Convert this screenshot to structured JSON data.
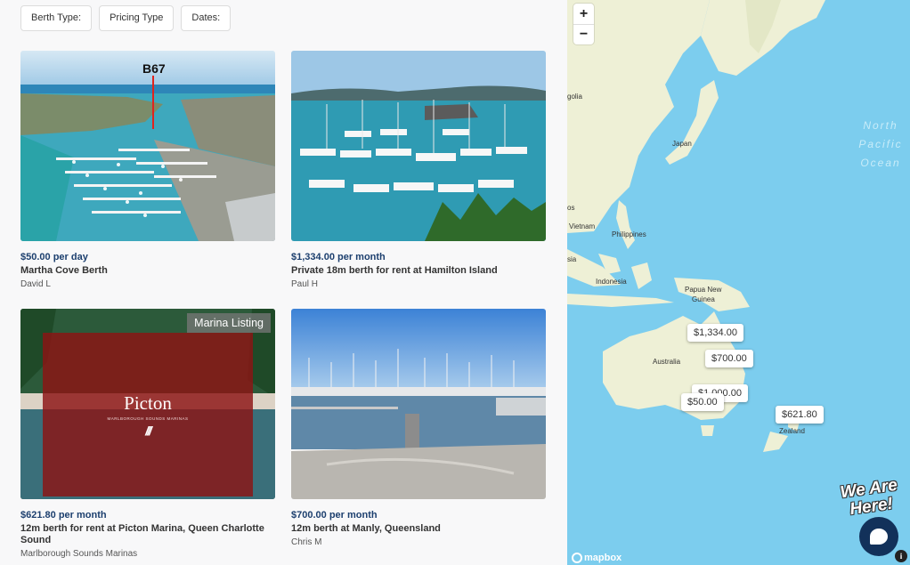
{
  "filters": [
    "Berth Type:",
    "Pricing Type",
    "Dates:"
  ],
  "listings": [
    {
      "price": "$50.00",
      "period": " per day",
      "title": "Martha Cove Berth",
      "owner": "David L",
      "photo_label": "B67",
      "badge": ""
    },
    {
      "price": "$1,334.00",
      "period": " per month",
      "title": "Private 18m berth for rent at Hamilton Island",
      "owner": "Paul H",
      "photo_label": "",
      "badge": ""
    },
    {
      "price": "$621.80",
      "period": " per month",
      "title": "12m berth for rent at Picton Marina, Queen Charlotte Sound",
      "owner": "Marlborough Sounds Marinas",
      "photo_label": "",
      "badge": "Marina Listing",
      "logo_text": "Picton",
      "logo_sub": "MARLBOROUGH SOUNDS MARINAS"
    },
    {
      "price": "$700.00",
      "period": " per month",
      "title": "12m berth at Manly, Queensland",
      "owner": "Chris M",
      "photo_label": "",
      "badge": ""
    }
  ],
  "map": {
    "zoom_in": "+",
    "zoom_out": "−",
    "labels": {
      "mongolia": "golia",
      "japan": "Japan",
      "vietnam": "Vietnam",
      "philippines": "Philippines",
      "indonesia": "Indonesia",
      "png_1": "Papua New",
      "png_2": "Guinea",
      "australia": "Australia",
      "zealand": "Zealand",
      "cut_1": "os",
      "cut_2": "sia"
    },
    "ocean": [
      "North",
      "Pacific",
      "Ocean"
    ],
    "pins": [
      "$1,334.00",
      "$700.00",
      "$1,000.00",
      "$50.00",
      "$621.80"
    ],
    "attribution": "mapbox",
    "info": "i"
  },
  "chat": {
    "banner_1": "We Are",
    "banner_2": "Here!"
  },
  "colors": {
    "price": "#1c3f6e",
    "ocean": "#7ccdee",
    "land": "#eef0d6"
  }
}
